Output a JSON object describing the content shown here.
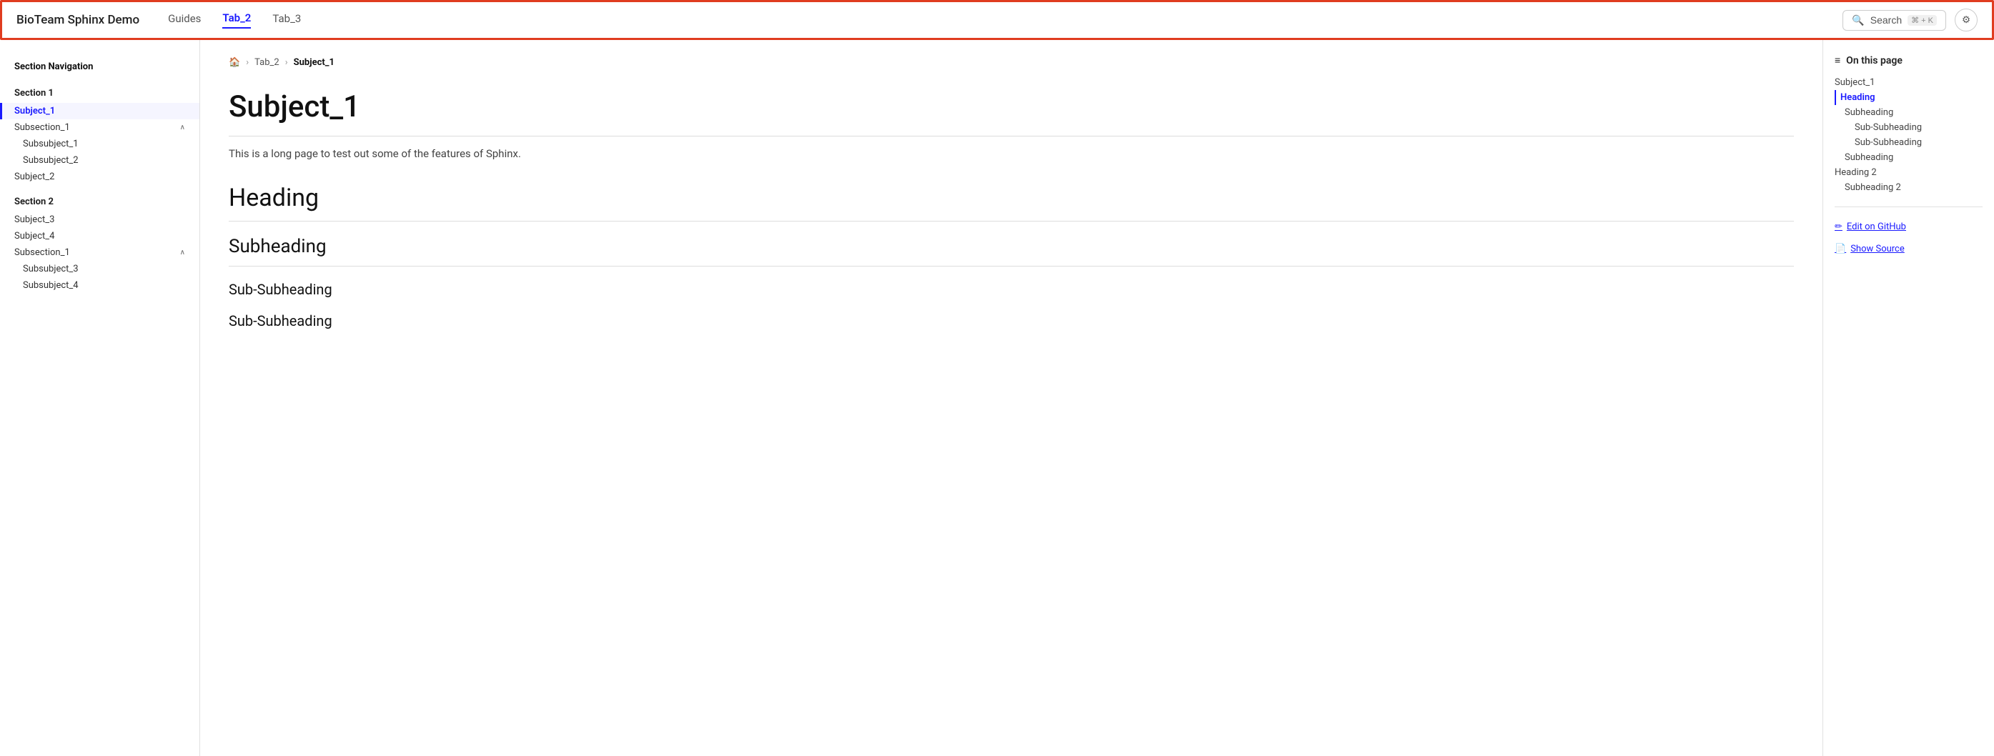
{
  "header": {
    "brand": "BioTeam Sphinx Demo",
    "nav_tabs": [
      {
        "label": "Guides",
        "active": false
      },
      {
        "label": "Tab_2",
        "active": true
      },
      {
        "label": "Tab_3",
        "active": false
      }
    ],
    "search": {
      "label": "Search",
      "shortcut": "⌘ + K"
    },
    "settings_icon": "gear-icon"
  },
  "left_sidebar": {
    "title": "Section Navigation",
    "sections": [
      {
        "label": "Section 1",
        "items": [
          {
            "label": "Subject_1",
            "active": true,
            "indent": 0
          },
          {
            "label": "Subsection_1",
            "indent": 0,
            "expandable": true,
            "expanded": true
          },
          {
            "label": "Subsubject_1",
            "indent": 1
          },
          {
            "label": "Subsubject_2",
            "indent": 1
          },
          {
            "label": "Subject_2",
            "indent": 0
          }
        ]
      },
      {
        "label": "Section 2",
        "items": [
          {
            "label": "Subject_3",
            "indent": 0
          },
          {
            "label": "Subject_4",
            "indent": 0
          },
          {
            "label": "Subsection_1",
            "indent": 0,
            "expandable": true,
            "expanded": true
          },
          {
            "label": "Subsubject_3",
            "indent": 1
          },
          {
            "label": "Subsubject_4",
            "indent": 1
          }
        ]
      }
    ]
  },
  "breadcrumb": {
    "home_icon": "home-icon",
    "items": [
      "Tab_2",
      "Subject_1"
    ]
  },
  "main_content": {
    "page_title": "Subject_1",
    "intro": "This is a long page to test out some of the features of Sphinx.",
    "headings": [
      {
        "level": "h1",
        "text": "Heading"
      },
      {
        "level": "h2",
        "text": "Subheading"
      },
      {
        "level": "h3",
        "text": "Sub-Subheading"
      },
      {
        "level": "h3",
        "text": "Sub-Subheading"
      }
    ]
  },
  "right_sidebar": {
    "on_this_page_label": "On this page",
    "toc_items": [
      {
        "label": "Subject_1",
        "indent": 0,
        "active": false
      },
      {
        "label": "Heading",
        "indent": 0,
        "active": true
      },
      {
        "label": "Subheading",
        "indent": 1,
        "active": false
      },
      {
        "label": "Sub-Subheading",
        "indent": 2,
        "active": false
      },
      {
        "label": "Sub-Subheading",
        "indent": 2,
        "active": false
      },
      {
        "label": "Subheading",
        "indent": 1,
        "active": false
      },
      {
        "label": "Heading 2",
        "indent": 0,
        "active": false
      },
      {
        "label": "Subheading 2",
        "indent": 1,
        "active": false
      }
    ],
    "edit_on_github": "Edit on GitHub",
    "show_source": "Show Source"
  }
}
